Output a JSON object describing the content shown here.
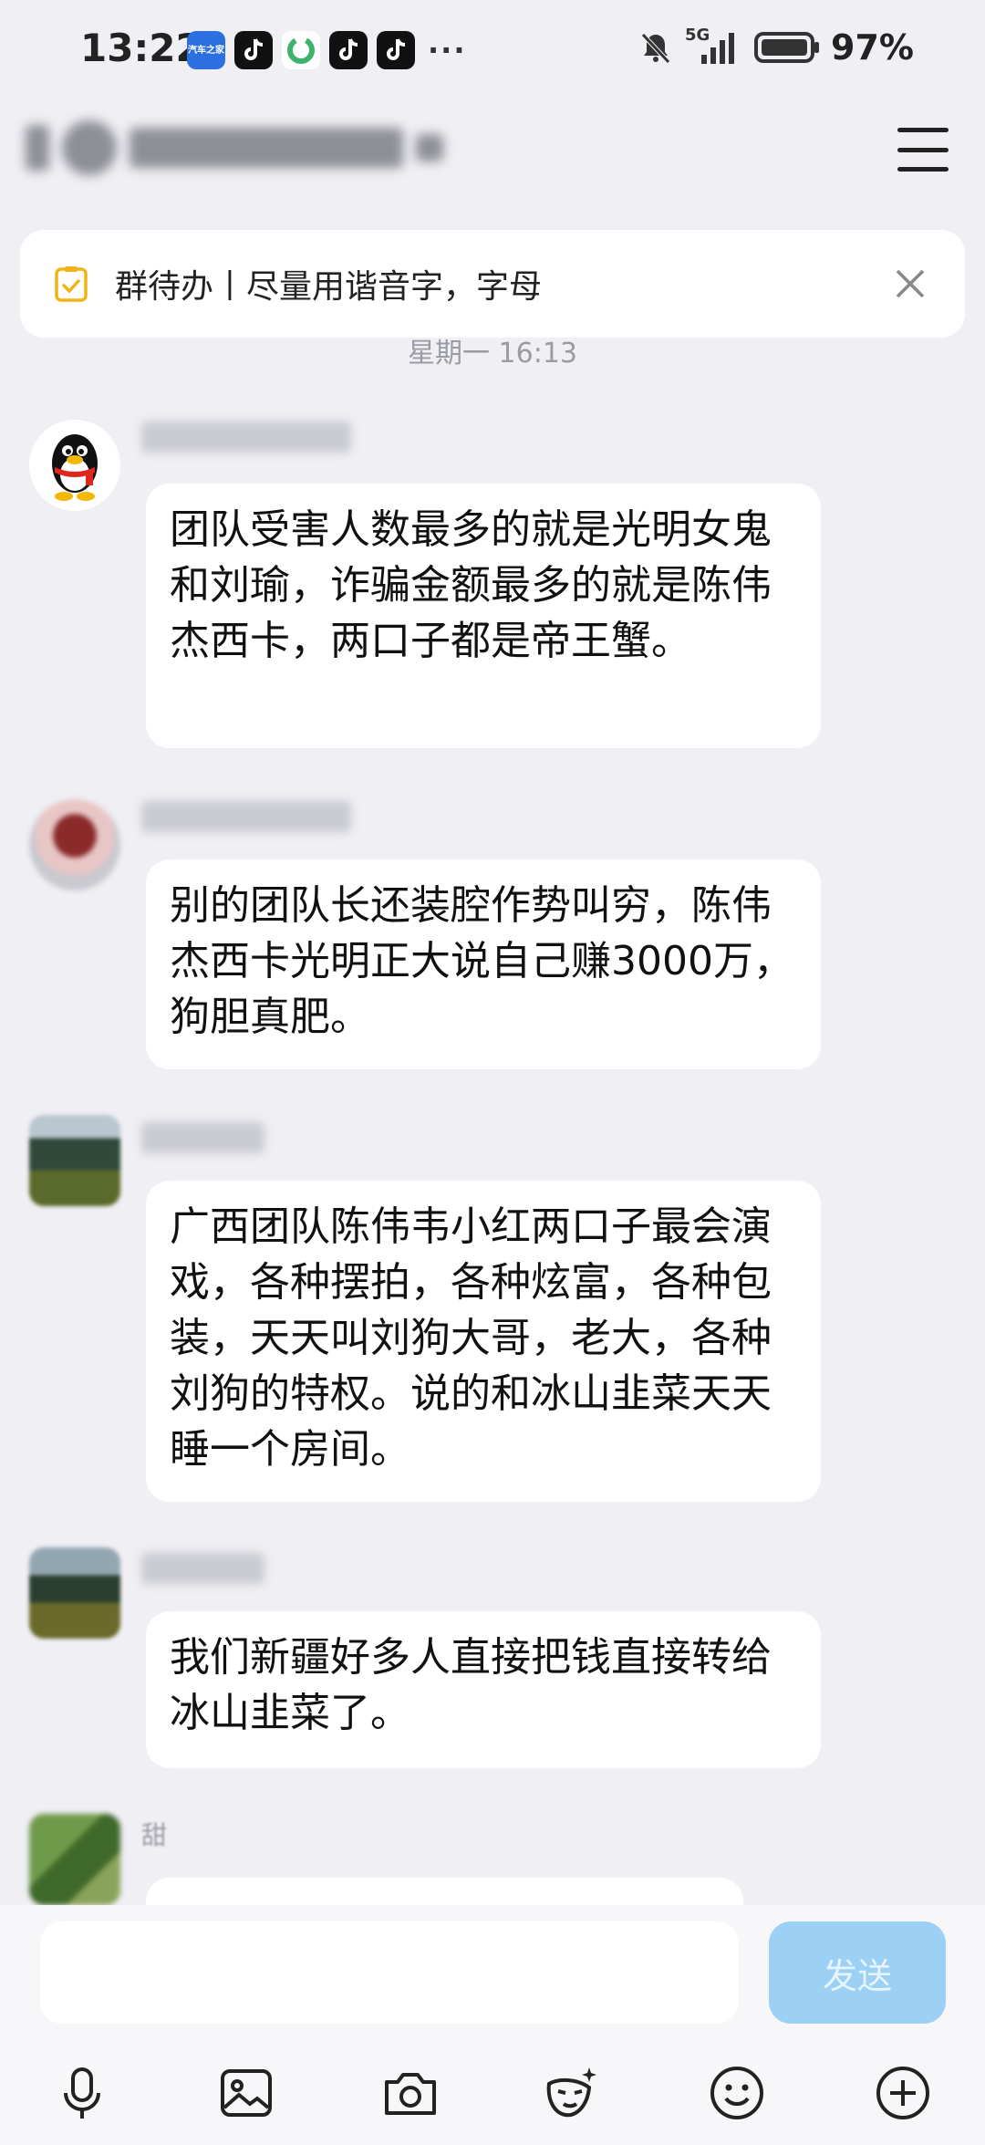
{
  "status": {
    "time": "13:22",
    "net": "5G",
    "battery": "97%",
    "more": "···",
    "app_car_label": "汽车之家"
  },
  "header": {
    "title_blurred": true
  },
  "todo": {
    "text": "群待办丨尽量用谐音字，字母"
  },
  "timestamp": "星期一 16:13",
  "messages": [
    {
      "avatar": "penguin-avatar",
      "text": "团队受害人数最多的就是光明女鬼和刘瑜，诈骗金额最多的就是陈伟杰西卡，两口子都是帝王蟹。"
    },
    {
      "avatar": "blurred-avatar",
      "text": "别的团队长还装腔作势叫穷，陈伟杰西卡光明正大说自己赚3000万，狗胆真肥。"
    },
    {
      "avatar": "landscape-avatar",
      "text": "广西团队陈伟韦小红两口子最会演戏，各种摆拍，各种炫富，各种包装，天天叫刘狗大哥，老大，各种刘狗的特权。说的和冰山韭菜天天睡一个房间。"
    },
    {
      "avatar": "landscape-avatar",
      "text": "我们新疆好多人直接把钱直接转给冰山韭菜了。"
    },
    {
      "avatar": "green-avatar",
      "nick_visible": "甜",
      "text": ""
    }
  ],
  "input": {
    "placeholder": "",
    "send_label": "发送"
  },
  "toolbar": [
    "microphone-icon",
    "image-icon",
    "camera-icon",
    "mask-emoji-icon",
    "smiley-icon",
    "plus-icon"
  ],
  "colors": {
    "background": "#efeff4",
    "send_disabled": "#9cd0f5",
    "todo_icon": "#f2b318"
  }
}
